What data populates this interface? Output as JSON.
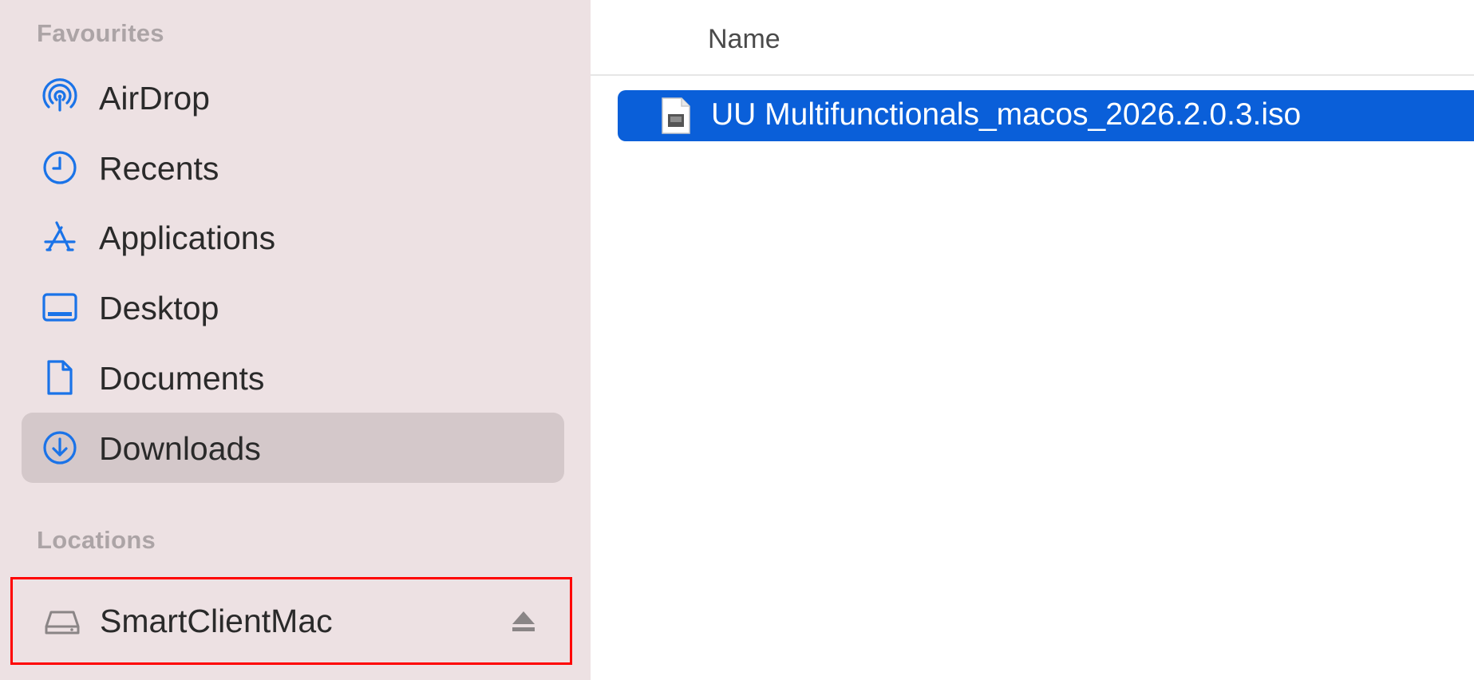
{
  "sidebar": {
    "favourites_header": "Favourites",
    "favourites": [
      {
        "label": "AirDrop",
        "icon": "airdrop-icon"
      },
      {
        "label": "Recents",
        "icon": "clock-icon"
      },
      {
        "label": "Applications",
        "icon": "applications-icon"
      },
      {
        "label": "Desktop",
        "icon": "desktop-icon"
      },
      {
        "label": "Documents",
        "icon": "document-icon"
      },
      {
        "label": "Downloads",
        "icon": "download-icon",
        "selected": true
      }
    ],
    "locations_header": "Locations",
    "locations": [
      {
        "label": "SmartClientMac",
        "icon": "drive-icon",
        "eject_icon": "eject-icon"
      }
    ]
  },
  "file_list": {
    "column_name": "Name",
    "files": [
      {
        "name": "UU Multifunctionals_macos_2026.2.0.3.iso",
        "icon": "disk-image-icon",
        "selected": true
      }
    ]
  },
  "colors": {
    "sidebar_bg": "#ede1e3",
    "selected_sidebar_bg": "#d4c8ca",
    "accent_blue": "#0a5fd9",
    "icon_blue": "#1a73e8",
    "highlight_border": "#ff0000"
  }
}
